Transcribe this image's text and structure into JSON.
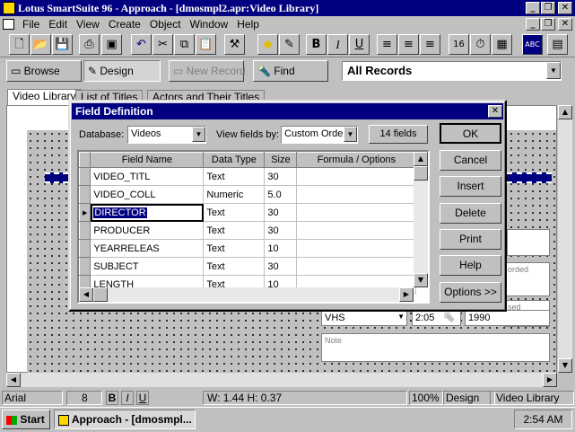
{
  "window": {
    "title": "Lotus SmartSuite 96   -   Approach - [dmosmpl2.apr:Video Library]"
  },
  "menu": [
    "File",
    "Edit",
    "View",
    "Create",
    "Object",
    "Window",
    "Help"
  ],
  "actionbar": {
    "browse": "Browse",
    "design": "Design",
    "new_record": "New Record",
    "find": "Find",
    "records_select": "All Records"
  },
  "tabs": [
    "Video Library",
    "List of Titles",
    "Actors and Their Titles"
  ],
  "dialog": {
    "title": "Field Definition",
    "database_label": "Database:",
    "database_value": "Videos",
    "viewby_label": "View fields by:",
    "viewby_value": "Custom Order",
    "field_count": "14 fields",
    "buttons": {
      "ok": "OK",
      "cancel": "Cancel",
      "insert": "Insert",
      "delete": "Delete",
      "print": "Print",
      "help": "Help",
      "options": "Options >>"
    },
    "columns": [
      "Field Name",
      "Data Type",
      "Size",
      "Formula / Options"
    ],
    "rows": [
      {
        "name": "VIDEO_TITL",
        "type": "Text",
        "size": "30",
        "formula": ""
      },
      {
        "name": "VIDEO_COLL",
        "type": "Numeric",
        "size": "5.0",
        "formula": ""
      },
      {
        "name": "DIRECTOR",
        "type": "Text",
        "size": "30",
        "formula": ""
      },
      {
        "name": "PRODUCER",
        "type": "Text",
        "size": "30",
        "formula": ""
      },
      {
        "name": "YEARRELEAS",
        "type": "Text",
        "size": "10",
        "formula": ""
      },
      {
        "name": "SUBJECT",
        "type": "Text",
        "size": "30",
        "formula": ""
      },
      {
        "name": "LENGTH",
        "type": "Text",
        "size": "10",
        "formula": ""
      }
    ]
  },
  "form": {
    "format": "VHS",
    "length": "2:05",
    "year": "1990",
    "recorded_label": "orded",
    "purchased_label": "sed",
    "note_label": "Note"
  },
  "status": {
    "font": "Arial",
    "size": "8",
    "bold": "B",
    "italic": "I",
    "underline": "U",
    "dims": "W: 1.44  H: 0.37",
    "zoom": "100%",
    "mode": "Design",
    "view": "Video Library"
  },
  "taskbar": {
    "start": "Start",
    "task": "Approach - [dmosmpl...",
    "clock": "2:54 AM"
  }
}
